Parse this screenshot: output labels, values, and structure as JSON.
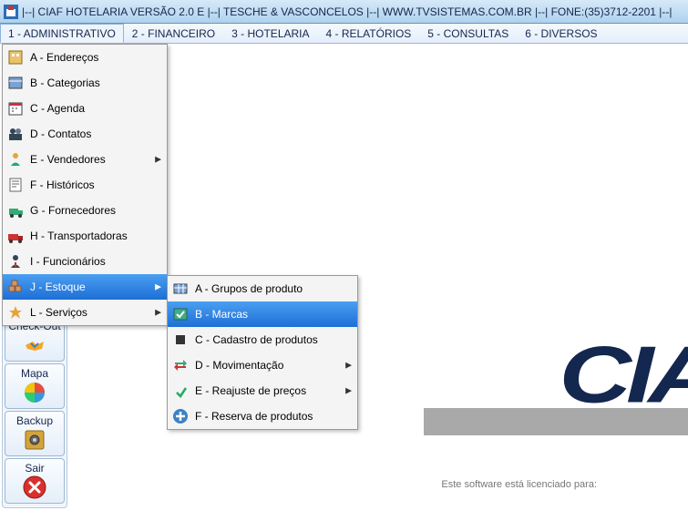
{
  "title": "|--| CIAF HOTELARIA VERSÃO 2.0 E |--| TESCHE & VASCONCELOS |--| WWW.TVSISTEMAS.COM.BR |--| FONE:(35)3712-2201 |--|",
  "menubar": {
    "items": [
      {
        "label": "1 - ADMINISTRATIVO"
      },
      {
        "label": "2 - FINANCEIRO"
      },
      {
        "label": "3 - HOTELARIA"
      },
      {
        "label": "4 - RELATÓRIOS"
      },
      {
        "label": "5 - CONSULTAS"
      },
      {
        "label": "6 - DIVERSOS"
      }
    ]
  },
  "admin_menu": {
    "items": [
      {
        "icon": "address-icon",
        "label": "A - Endereços",
        "has_sub": false
      },
      {
        "icon": "category-icon",
        "label": "B - Categorias",
        "has_sub": false
      },
      {
        "icon": "calendar-icon",
        "label": "C - Agenda",
        "has_sub": false
      },
      {
        "icon": "contacts-icon",
        "label": "D - Contatos",
        "has_sub": false
      },
      {
        "icon": "seller-icon",
        "label": "E - Vendedores",
        "has_sub": true
      },
      {
        "icon": "history-icon",
        "label": "F - Históricos",
        "has_sub": false
      },
      {
        "icon": "supplier-icon",
        "label": "G - Fornecedores",
        "has_sub": false
      },
      {
        "icon": "carrier-icon",
        "label": "H - Transportadoras",
        "has_sub": false
      },
      {
        "icon": "employee-icon",
        "label": "I - Funcionários",
        "has_sub": false
      },
      {
        "icon": "stock-icon",
        "label": "J - Estoque",
        "has_sub": true,
        "highlighted": true
      },
      {
        "icon": "service-icon",
        "label": "L - Serviços",
        "has_sub": true
      }
    ]
  },
  "stock_submenu": {
    "items": [
      {
        "icon": "group-icon",
        "label": "A - Grupos de produto",
        "has_sub": false
      },
      {
        "icon": "brand-icon",
        "label": "B - Marcas",
        "has_sub": false,
        "highlighted": true
      },
      {
        "icon": "product-icon",
        "label": "C - Cadastro de produtos",
        "has_sub": false
      },
      {
        "icon": "movement-icon",
        "label": "D - Movimentação",
        "has_sub": true
      },
      {
        "icon": "price-icon",
        "label": "E - Reajuste de preços",
        "has_sub": true
      },
      {
        "icon": "reserve-icon",
        "label": "F - Reserva de produtos",
        "has_sub": false
      }
    ]
  },
  "toolbar": {
    "checkout": "Check-Out",
    "map": "Mapa",
    "backup": "Backup",
    "exit": "Sair"
  },
  "logo": "CIA",
  "license": "Este software está licenciado para:"
}
